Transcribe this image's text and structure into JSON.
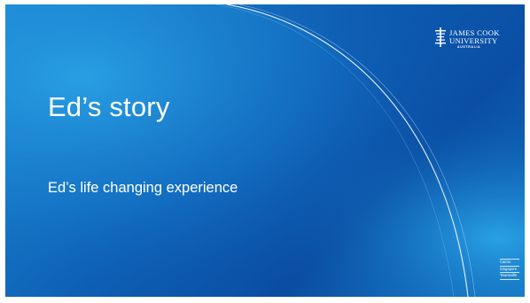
{
  "slide": {
    "title": "Ed’s story",
    "subtitle": "Ed’s life changing experience"
  },
  "logo": {
    "line1": "JAMES COOK",
    "line2": "UNIVERSITY",
    "line3": "AUSTRALIA"
  },
  "campuses": [
    "Cairns",
    "Singapore",
    "Townsville"
  ],
  "colors": {
    "background_light": "#1e8fd6",
    "background_dark": "#0a4da3",
    "text": "#ffffff"
  }
}
